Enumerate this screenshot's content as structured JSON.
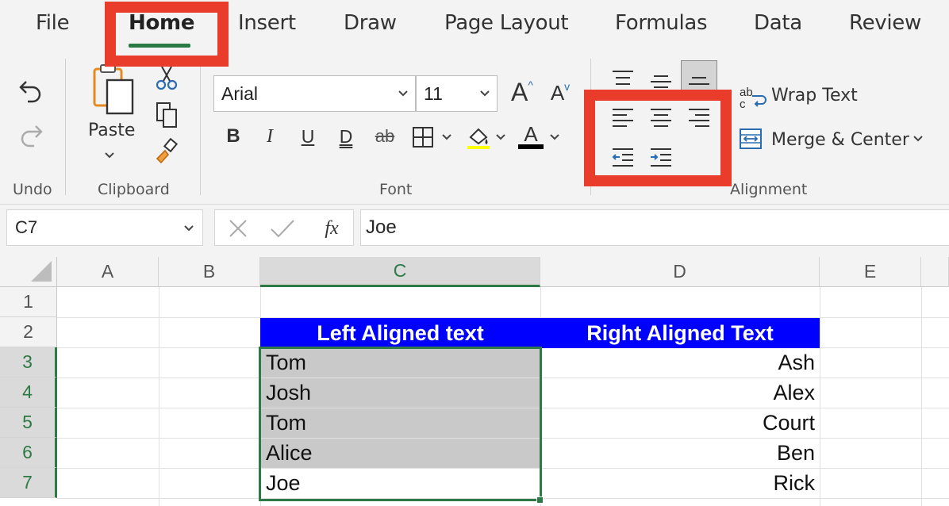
{
  "menu": {
    "tabs": [
      {
        "label": "File"
      },
      {
        "label": "Home"
      },
      {
        "label": "Insert"
      },
      {
        "label": "Draw"
      },
      {
        "label": "Page Layout"
      },
      {
        "label": "Formulas"
      },
      {
        "label": "Data"
      },
      {
        "label": "Review"
      }
    ],
    "active_tab": "Home"
  },
  "ribbon": {
    "groups": {
      "undo": "Undo",
      "clipboard": "Clipboard",
      "font": "Font",
      "alignment": "Alignment"
    },
    "paste_label": "Paste",
    "font_name": "Arial",
    "font_size": "11",
    "wrap_text": "Wrap Text",
    "merge_center": "Merge & Center",
    "icons": [
      "undo-icon",
      "redo-icon",
      "paste-icon",
      "cut-icon",
      "copy-icon",
      "format-painter-icon",
      "increase-font-icon",
      "decrease-font-icon",
      "bold-icon",
      "italic-icon",
      "underline-icon",
      "double-underline-icon",
      "strikethrough-icon",
      "borders-icon",
      "fill-color-icon",
      "font-color-icon",
      "align-top-icon",
      "align-middle-icon",
      "align-bottom-icon",
      "align-left-icon",
      "align-center-icon",
      "align-right-icon",
      "decrease-indent-icon",
      "increase-indent-icon",
      "wrap-text-icon",
      "merge-center-icon"
    ],
    "glyphs": {
      "bold": "B",
      "italic": "I",
      "underline": "U",
      "double_underline": "D",
      "strikethrough": "ab",
      "font_grow": "A",
      "font_shrink": "A",
      "font_color": "A",
      "wrap_ab": "ab",
      "wrap_c": "c"
    }
  },
  "formula_bar": {
    "name_box": "C7",
    "fx": "fx",
    "content": "Joe"
  },
  "sheet": {
    "columns": [
      "A",
      "B",
      "C",
      "D",
      "E"
    ],
    "selected_column": "C",
    "rows": [
      "1",
      "2",
      "3",
      "4",
      "5",
      "6",
      "7"
    ],
    "selected_rows": [
      "3",
      "4",
      "5",
      "6",
      "7"
    ],
    "header_row": {
      "c": "Left Aligned text",
      "d": "Right Aligned Text"
    },
    "data": [
      {
        "c": "Tom",
        "d": "Ash"
      },
      {
        "c": "Josh",
        "d": "Alex"
      },
      {
        "c": "Tom",
        "d": "Court"
      },
      {
        "c": "Alice",
        "d": "Ben"
      },
      {
        "c": "Joe",
        "d": "Rick"
      }
    ],
    "colors": {
      "header_fill": "#0000ff",
      "selection": "#2d7a46",
      "highlight_fill": "#c9c9c9",
      "callout": "#ea3c2a"
    }
  }
}
